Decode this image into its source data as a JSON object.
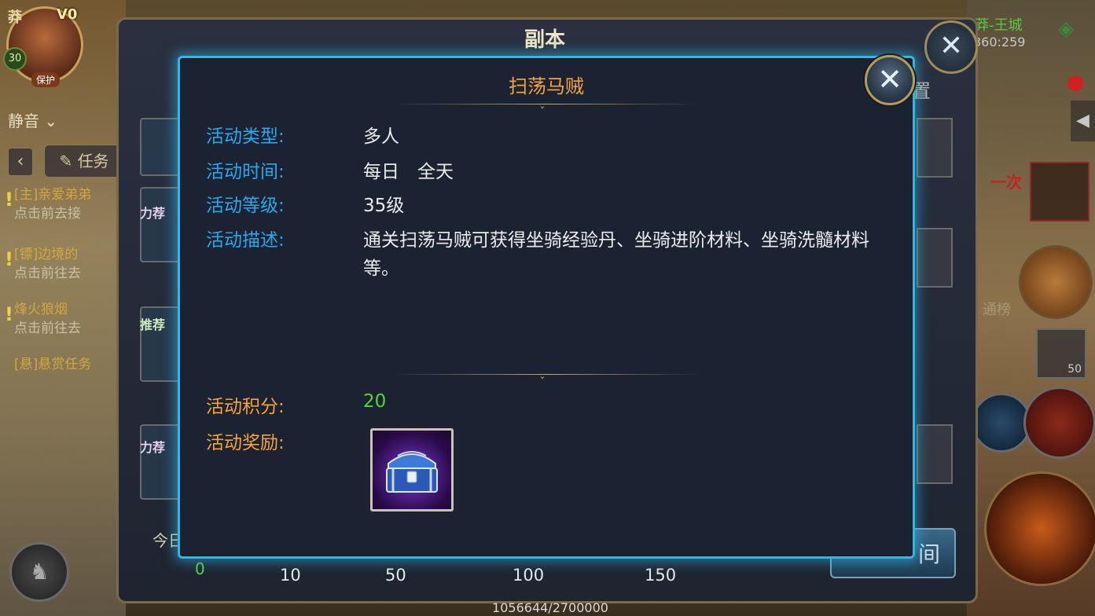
{
  "background": {
    "player": {
      "vip": "V0",
      "level": "30",
      "guard_label": "保护",
      "name_char": "莽"
    },
    "mute_label": "静音",
    "task_tab_label": "任务",
    "quests": [
      {
        "title": "[主]亲爱弟弟",
        "sub": "点击前去接"
      },
      {
        "title": "[镖]边境的",
        "sub": "点击前往去"
      },
      {
        "title": "烽火狼烟",
        "sub": "点击前往去"
      },
      {
        "title": "[悬]悬赏任务",
        "sub": ""
      }
    ],
    "location": "莽-王城",
    "coords": "360:259",
    "right_slot_count": "50",
    "pet_label": "通榜",
    "red_text": "一次"
  },
  "back_panel": {
    "title": "副本",
    "tab_label": "置",
    "ribbons": [
      "力荐",
      "推荐",
      "力荐"
    ],
    "today_label": "今日",
    "progress_start": "0",
    "ticks": [
      "10",
      "50",
      "100",
      "150"
    ],
    "exp_text": "1056644/2700000",
    "action_button": "间"
  },
  "modal": {
    "title": "扫荡马贼",
    "rows": [
      {
        "label": "活动类型:",
        "value": "多人"
      },
      {
        "label": "活动时间:",
        "value": "每日　全天"
      },
      {
        "label": "活动等级:",
        "value": "35级"
      },
      {
        "label": "活动描述:",
        "value": "通关扫荡马贼可获得坐骑经验丹、坐骑进阶材料、坐骑洗髓材料等。"
      }
    ],
    "score_label": "活动积分:",
    "score_value": "20",
    "reward_label": "活动奖励:",
    "reward_item_icon": "treasure-chest-icon"
  },
  "colors": {
    "accent_blue": "#2aa8ec",
    "title_orange": "#f3a43a",
    "score_green": "#5ad23c",
    "modal_border": "#2fb7e8",
    "modal_bg": "#1b2232"
  }
}
